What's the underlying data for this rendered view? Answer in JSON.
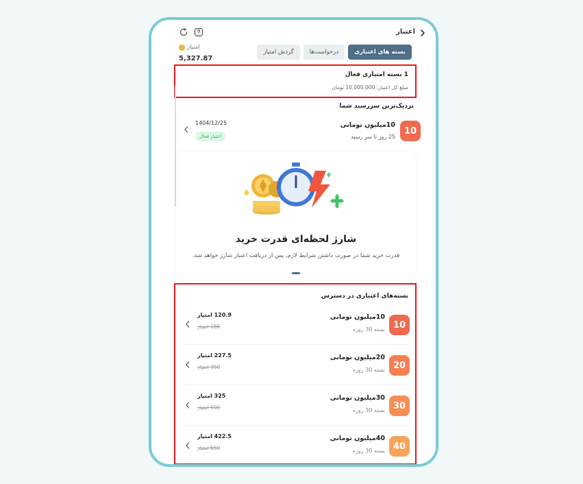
{
  "header": {
    "title": "اعتبار",
    "back_icon": "chevron-left-icon",
    "refresh_icon": "refresh-icon",
    "help_icon": "question-icon"
  },
  "tabs": [
    {
      "label": "بسته های اعتباری",
      "active": true
    },
    {
      "label": "درخواست‌ها",
      "active": false
    },
    {
      "label": "گردش امتیاز",
      "active": false
    }
  ],
  "points": {
    "label": "امتیاز",
    "value": "5,327.87",
    "icon": "coin-icon"
  },
  "active_package": {
    "title": "1 بسته امتیازی فعال",
    "amount": "مبلغ کل اعتبار: 10,000,000 تومان"
  },
  "nearest": {
    "heading": "نزدیک‌ترین سررسید شما",
    "badge": "10",
    "name": "10میلیون تومانی",
    "remaining": "25 روز تا سر رسید",
    "date": "1404/12/25",
    "status": "اعتبار فعال"
  },
  "promo": {
    "title": "شارژ لحظه‌ای قدرت خرید",
    "description": "قدرت خرید شما در صورت داشتن شرایط لازم، پس از دریافت اعتبار شارژ خواهد شد."
  },
  "available": {
    "heading": "بسته‌های اعتباری در دسترس",
    "packages": [
      {
        "badge": "10",
        "name": "10میلیون تومانی",
        "duration": "بسته 30 روزه",
        "price": "120.9 امتیاز",
        "old_price": "186 امتیاز",
        "color": "#f06a4f"
      },
      {
        "badge": "20",
        "name": "20میلیون تومانی",
        "duration": "بسته 30 روزه",
        "price": "227.5 امتیاز",
        "old_price": "350 امتیاز",
        "color": "#f47f53"
      },
      {
        "badge": "30",
        "name": "30میلیون تومانی",
        "duration": "بسته 30 روزه",
        "price": "325 امتیاز",
        "old_price": "500 امتیاز",
        "color": "#f68e54"
      },
      {
        "badge": "40",
        "name": "40میلیون تومانی",
        "duration": "بسته 30 روزه",
        "price": "422.5 امتیاز",
        "old_price": "650 امتیاز",
        "color": "#f9a35a"
      }
    ]
  },
  "colors": {
    "accent": "#4f6e88",
    "frame": "#79ccd5",
    "highlight": "#e5161b",
    "success": "#2bb35b"
  }
}
